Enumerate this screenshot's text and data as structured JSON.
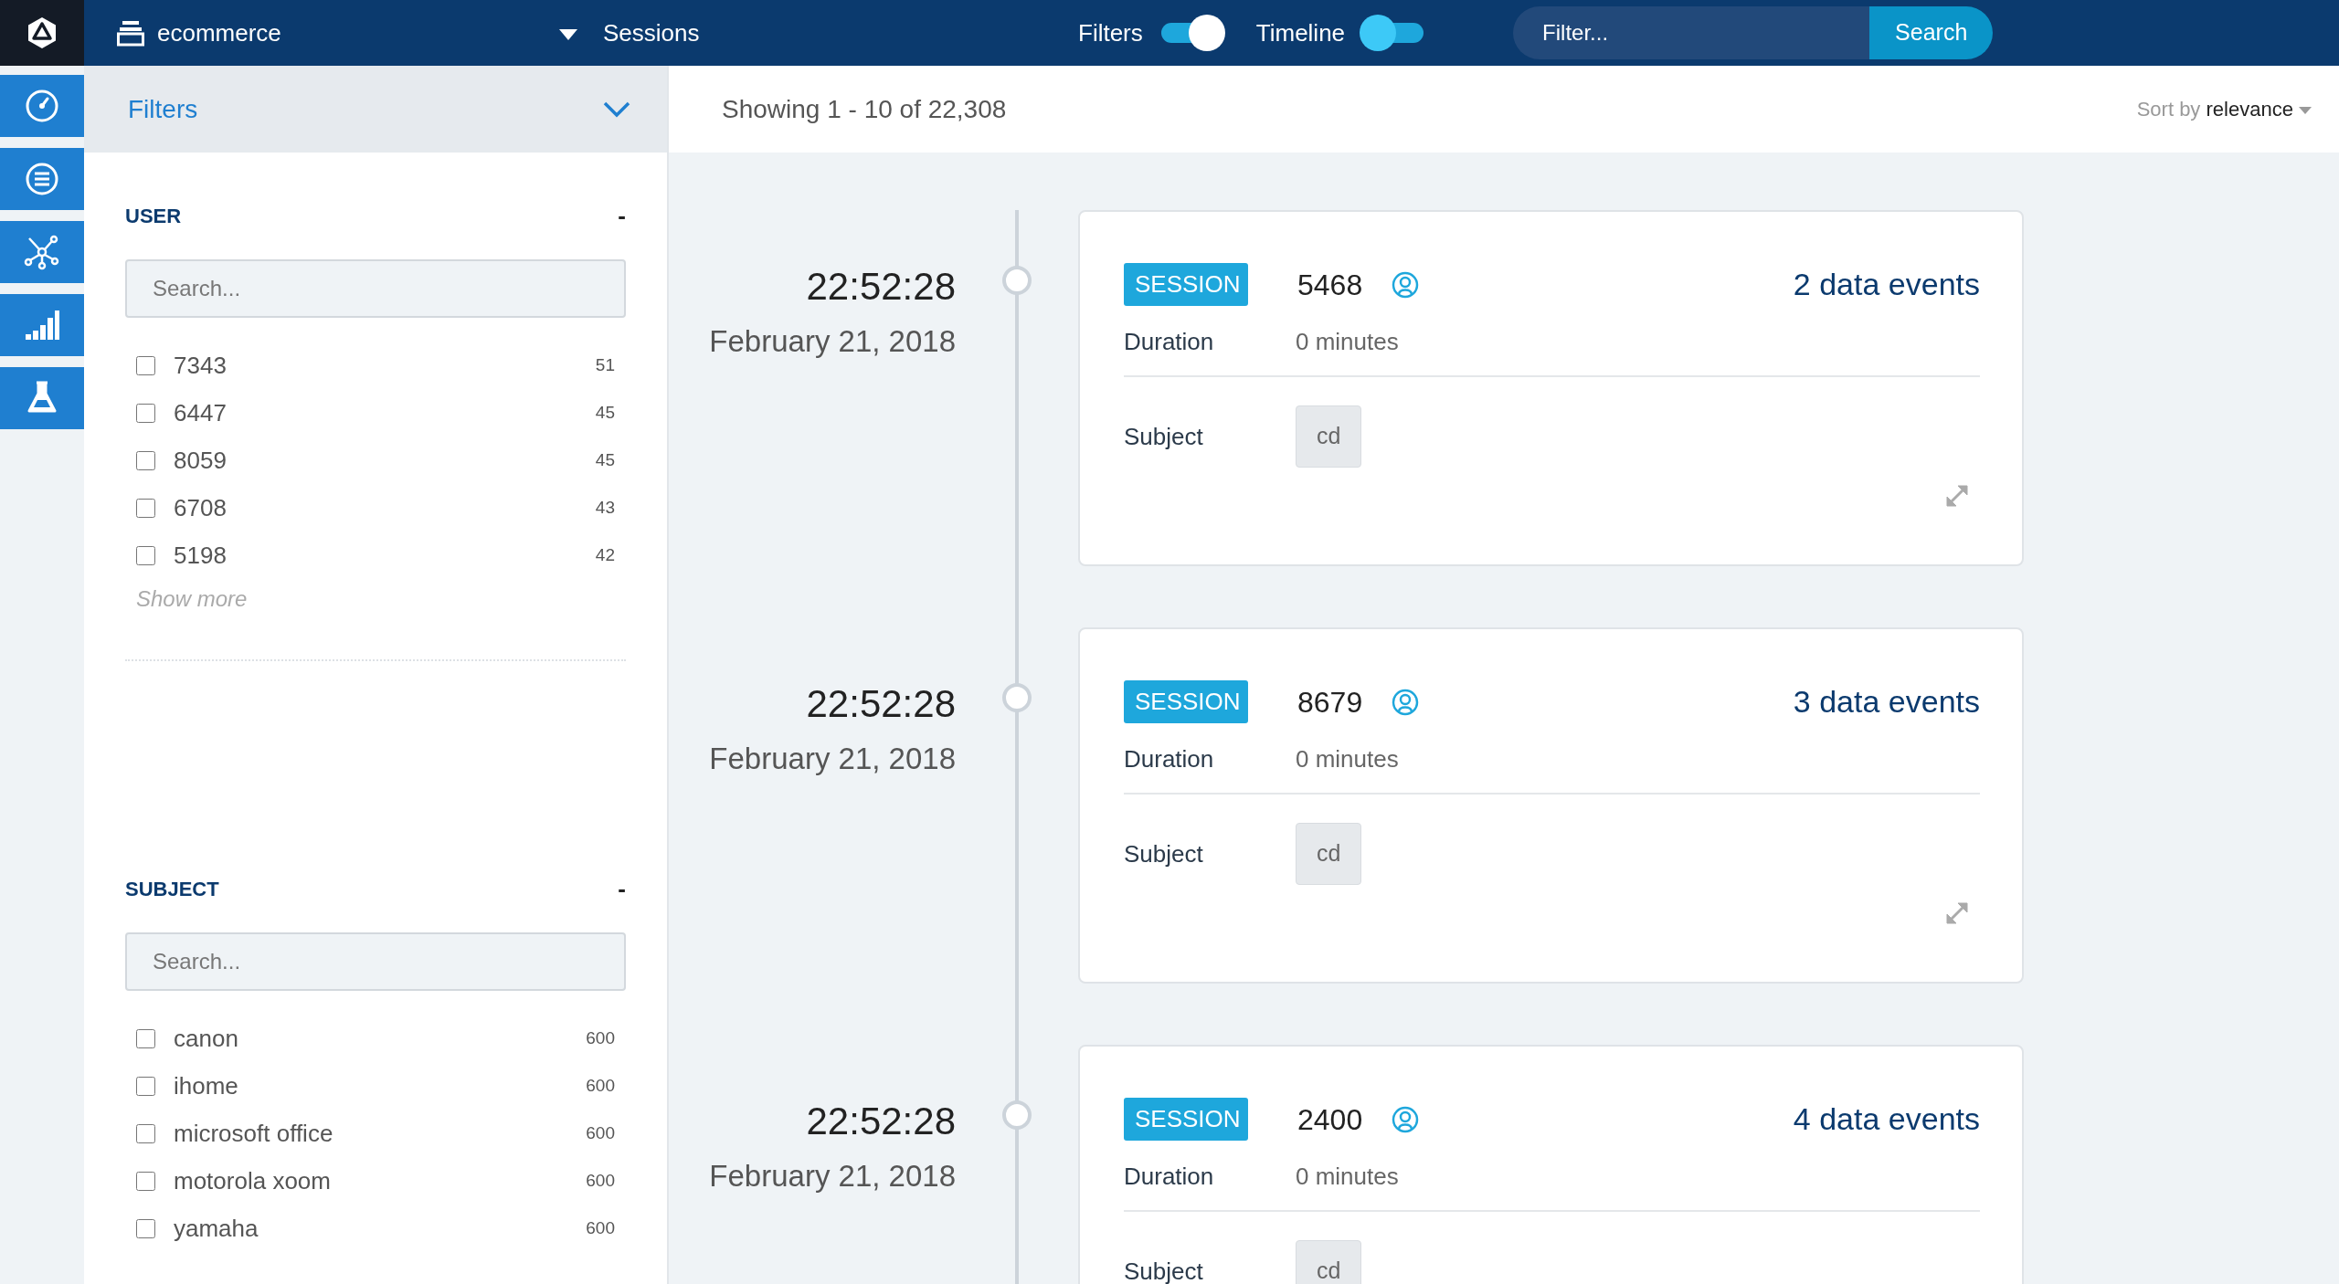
{
  "app": {
    "dataset": "ecommerce",
    "view": "Sessions"
  },
  "toggles": [
    {
      "label": "Filters",
      "on": true
    },
    {
      "label": "Timeline",
      "on": false
    }
  ],
  "search": {
    "placeholder": "Filter...",
    "button": "Search"
  },
  "rail": [
    {
      "kind": "gauge"
    },
    {
      "kind": "list"
    },
    {
      "kind": "network"
    },
    {
      "kind": "bars"
    },
    {
      "kind": "flask"
    }
  ],
  "filters_panel": {
    "title": "Filters",
    "groups": [
      {
        "title": "USER",
        "collapse": "-",
        "placeholder": "Search...",
        "items": [
          {
            "label": "7343",
            "count": "51",
            "checked": false
          },
          {
            "label": "6447",
            "count": "45",
            "checked": false
          },
          {
            "label": "8059",
            "count": "45",
            "checked": false
          },
          {
            "label": "6708",
            "count": "43",
            "checked": false
          },
          {
            "label": "5198",
            "count": "42",
            "checked": false
          }
        ],
        "show_more": "Show more"
      },
      {
        "title": "SUBJECT",
        "collapse": "-",
        "placeholder": "Search...",
        "items": [
          {
            "label": "canon",
            "count": "600",
            "checked": false
          },
          {
            "label": "ihome",
            "count": "600",
            "checked": false
          },
          {
            "label": "microsoft office",
            "count": "600",
            "checked": false
          },
          {
            "label": "motorola xoom",
            "count": "600",
            "checked": false
          },
          {
            "label": "yamaha",
            "count": "600",
            "checked": false
          }
        ]
      }
    ]
  },
  "results": {
    "summary": "Showing 1 - 10 of 22,308",
    "sort_label": "Sort by",
    "sort_value": "relevance"
  },
  "sessions": [
    {
      "time": "22:52:28",
      "date": "February 21, 2018",
      "badge": "SESSION",
      "id": "5468",
      "events": "2 data events",
      "expand_control": true,
      "fields": [
        {
          "kind": "text",
          "label": "Duration",
          "value": "0 minutes"
        },
        {
          "kind": "tag",
          "label": "Subject",
          "value": "cd"
        }
      ]
    },
    {
      "time": "22:52:28",
      "date": "February 21, 2018",
      "badge": "SESSION",
      "id": "8679",
      "events": "3 data events",
      "expand_control": true,
      "fields": [
        {
          "kind": "text",
          "label": "Duration",
          "value": "0 minutes"
        },
        {
          "kind": "tag",
          "label": "Subject",
          "value": "cd"
        }
      ]
    },
    {
      "time": "22:52:28",
      "date": "February 21, 2018",
      "badge": "SESSION",
      "id": "2400",
      "events": "4 data events",
      "fields": [
        {
          "kind": "text",
          "label": "Duration",
          "value": "0 minutes"
        },
        {
          "kind": "tag",
          "label": "Subject",
          "value": "cd"
        }
      ]
    }
  ]
}
